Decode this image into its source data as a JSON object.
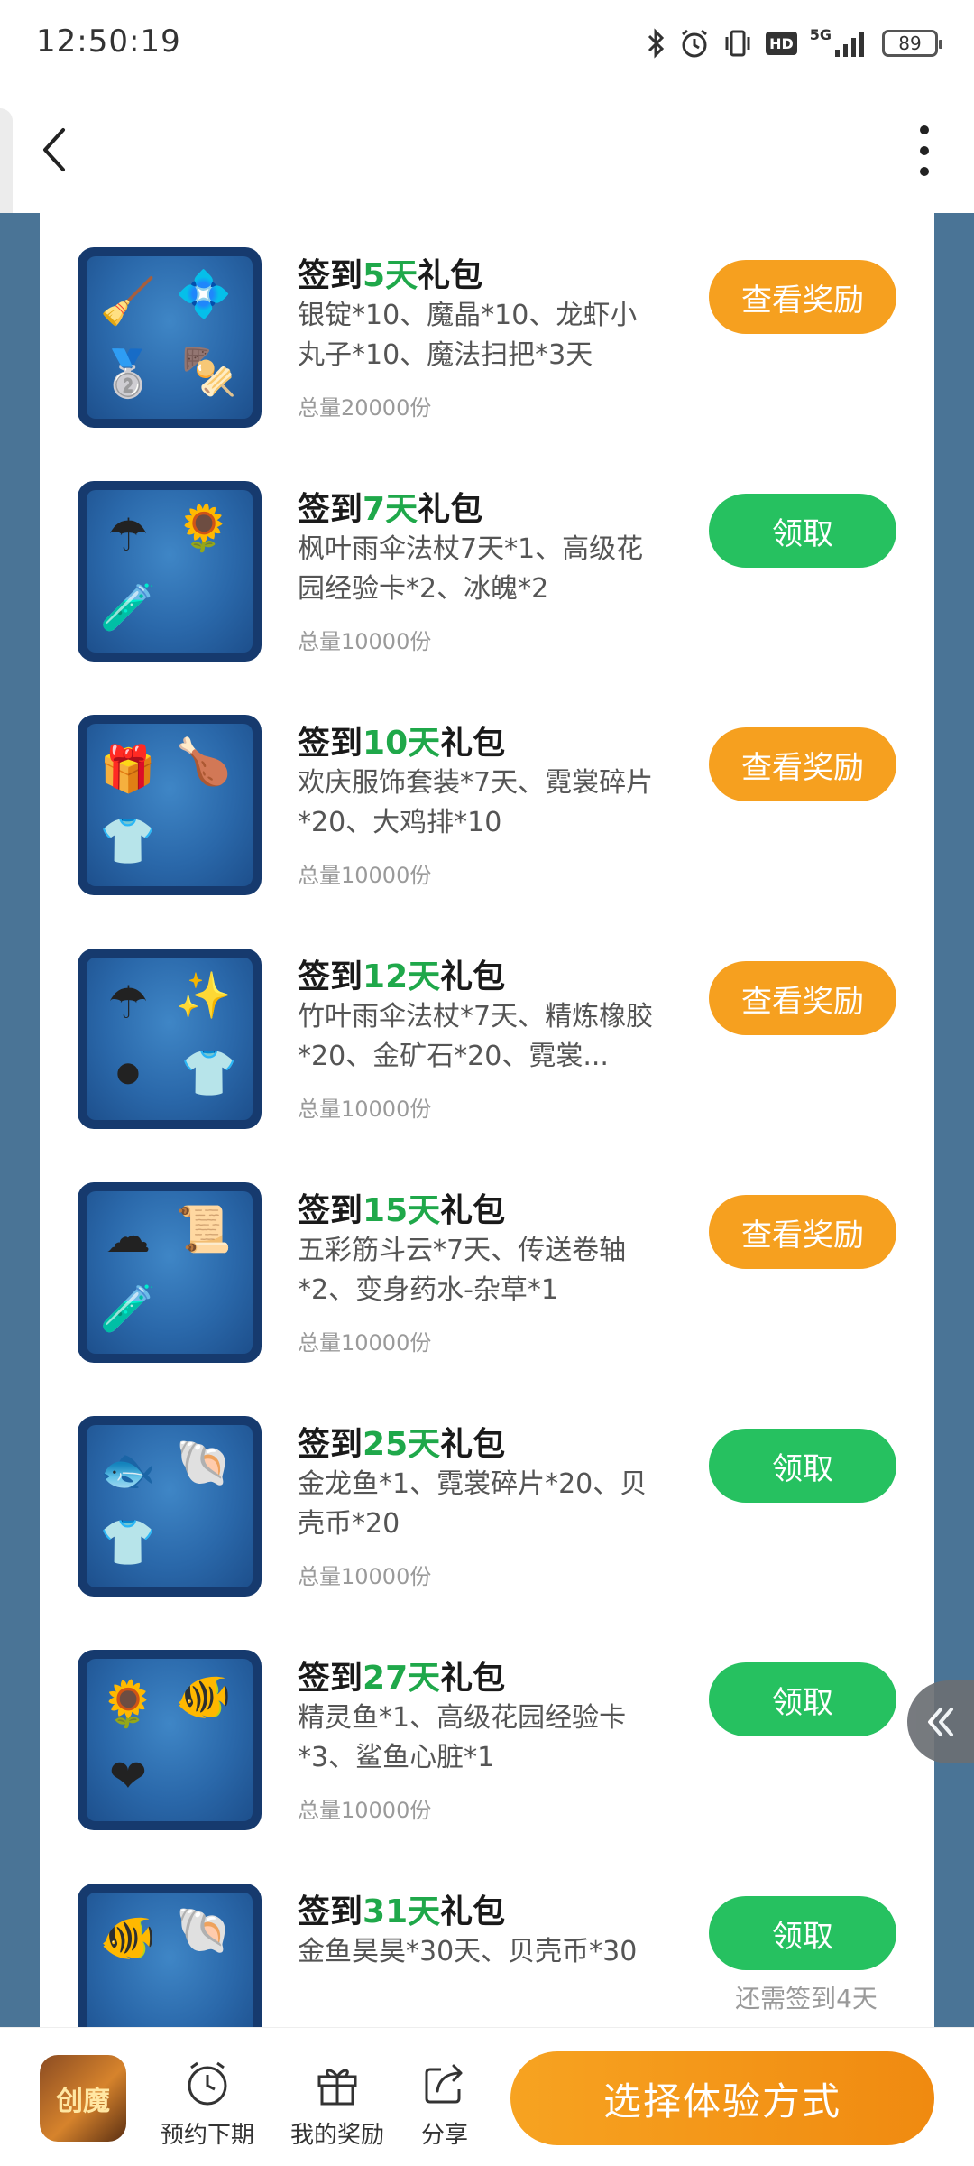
{
  "status_bar": {
    "time": "12:50:19",
    "network": "5G",
    "hd": "HD",
    "battery": "89"
  },
  "gifts": [
    {
      "prefix": "签到",
      "days": "5天",
      "suffix": "礼包",
      "desc": "银锭*10、魔晶*10、龙虾小丸子*10、魔法扫把*3天",
      "total": "总量20000份",
      "button": "查看奖励",
      "button_style": "orange",
      "remaining": "",
      "thumb_items": [
        "🧹",
        "💠",
        "🥈",
        "🍢"
      ]
    },
    {
      "prefix": "签到",
      "days": "7天",
      "suffix": "礼包",
      "desc": "枫叶雨伞法杖7天*1、高级花园经验卡*2、冰魄*2",
      "total": "总量10000份",
      "button": "领取",
      "button_style": "green",
      "remaining": "",
      "thumb_items": [
        "☂",
        "🌻",
        "🧪"
      ]
    },
    {
      "prefix": "签到",
      "days": "10天",
      "suffix": "礼包",
      "desc": "欢庆服饰套装*7天、霓裳碎片*20、大鸡排*10",
      "total": "总量10000份",
      "button": "查看奖励",
      "button_style": "orange",
      "remaining": "",
      "thumb_items": [
        "🎁",
        "🍗",
        "👕"
      ]
    },
    {
      "prefix": "签到",
      "days": "12天",
      "suffix": "礼包",
      "desc": "竹叶雨伞法杖*7天、精炼橡胶*20、金矿石*20、霓裳...",
      "total": "总量10000份",
      "button": "查看奖励",
      "button_style": "orange",
      "remaining": "",
      "thumb_items": [
        "☂",
        "✨",
        "⚫",
        "👕"
      ]
    },
    {
      "prefix": "签到",
      "days": "15天",
      "suffix": "礼包",
      "desc": "五彩筋斗云*7天、传送卷轴*2、变身药水-杂草*1",
      "total": "总量10000份",
      "button": "查看奖励",
      "button_style": "orange",
      "remaining": "",
      "thumb_items": [
        "☁",
        "📜",
        "🧪"
      ]
    },
    {
      "prefix": "签到",
      "days": "25天",
      "suffix": "礼包",
      "desc": "金龙鱼*1、霓裳碎片*20、贝壳币*20",
      "total": "总量10000份",
      "button": "领取",
      "button_style": "green",
      "remaining": "",
      "thumb_items": [
        "🐟",
        "🐚",
        "👕"
      ]
    },
    {
      "prefix": "签到",
      "days": "27天",
      "suffix": "礼包",
      "desc": "精灵鱼*1、高级花园经验卡*3、鲨鱼心脏*1",
      "total": "总量10000份",
      "button": "领取",
      "button_style": "green",
      "remaining": "",
      "thumb_items": [
        "🌻",
        "🐠",
        "❤"
      ]
    },
    {
      "prefix": "签到",
      "days": "31天",
      "suffix": "礼包",
      "desc": "金鱼昊昊*30天、贝壳币*30",
      "total": "",
      "button": "领取",
      "button_style": "green",
      "remaining": "还需签到4天",
      "thumb_items": [
        "🐠",
        "🐚"
      ]
    }
  ],
  "bottom_bar": {
    "app_icon_text": "创魔",
    "tools": [
      {
        "label": "预约下期",
        "icon": "alarm-clock-icon"
      },
      {
        "label": "我的奖励",
        "icon": "gift-box-icon"
      },
      {
        "label": "分享",
        "icon": "share-icon"
      }
    ],
    "cta": "选择体验方式"
  },
  "colors": {
    "accent_green": "#1fa84a",
    "button_orange": "#f6a01f",
    "button_green": "#26c160",
    "frame_blue": "#4a7496"
  }
}
